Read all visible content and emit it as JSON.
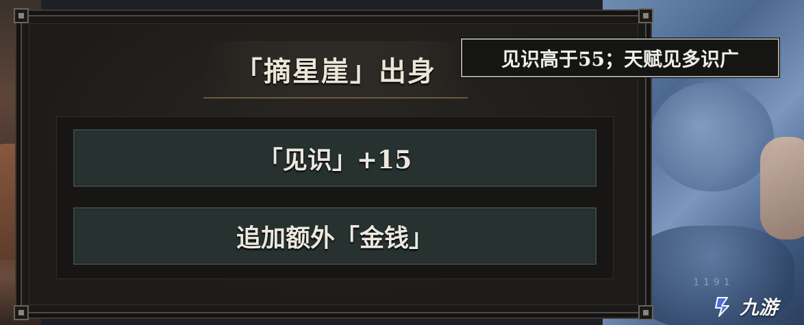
{
  "panel": {
    "title": "「摘星崖」出身"
  },
  "options": [
    {
      "label": "「见识」+15"
    },
    {
      "label": "追加额外「金钱」"
    }
  ],
  "tooltip": {
    "text": "见识高于55；天赋见多识广"
  },
  "watermark": {
    "text": "九游",
    "faint_text": "1191",
    "color": "#4a6fd8"
  },
  "colors": {
    "panel_bg": "#1a1917",
    "option_bg": "#263130",
    "title_text": "#ece6d8",
    "tooltip_border": "#a8a49c"
  }
}
